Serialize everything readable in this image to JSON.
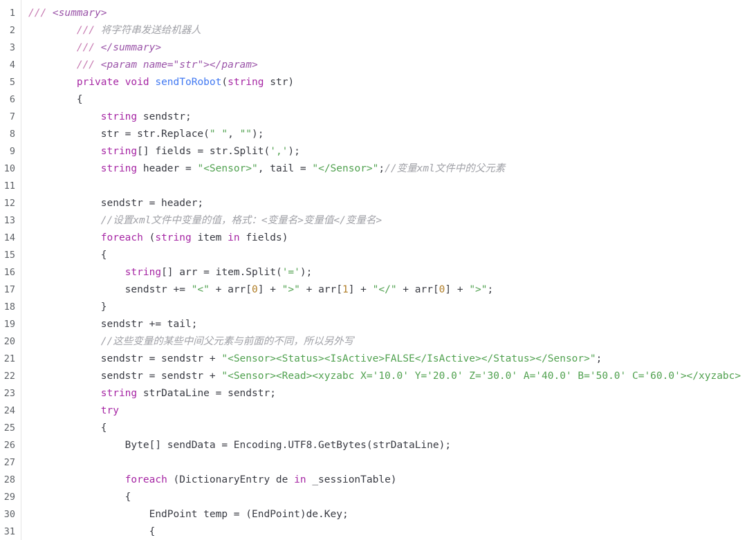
{
  "editor": {
    "language": "csharp",
    "background_color": "#ffffff",
    "gutter_divider_color": "#e4e4e4",
    "first_visible_line": 1,
    "last_visible_line": 31,
    "horizontal_overflow": true
  },
  "theme": {
    "plain": "#383a42",
    "keyword": "#a626a4",
    "type": "#a626a4",
    "function": "#4078f2",
    "string": "#50a14f",
    "number": "#b07d26",
    "comment": "#a0a1a7",
    "doc_slash": "#c678b0",
    "doc_tag": "#9a53a8",
    "line_number": "#5d6166"
  },
  "line_numbers": [
    "1",
    "2",
    "3",
    "4",
    "5",
    "6",
    "7",
    "8",
    "9",
    "10",
    "11",
    "12",
    "13",
    "14",
    "15",
    "16",
    "17",
    "18",
    "19",
    "20",
    "21",
    "22",
    "23",
    "24",
    "25",
    "26",
    "27",
    "28",
    "29",
    "30",
    "31"
  ],
  "code_lines": [
    {
      "number": "1",
      "text": "/// <summary>",
      "tokens": [
        {
          "t": "/// ",
          "c": "doc-slash"
        },
        {
          "t": "<summary>",
          "c": "doc-tag"
        }
      ]
    },
    {
      "number": "2",
      "text": "        /// 将字符串发送给机器人",
      "tokens": [
        {
          "t": "        ",
          "c": "plain"
        },
        {
          "t": "/// ",
          "c": "doc-slash"
        },
        {
          "t": "将字符串发送给机器人",
          "c": "comment"
        }
      ]
    },
    {
      "number": "3",
      "text": "        /// </summary>",
      "tokens": [
        {
          "t": "        ",
          "c": "plain"
        },
        {
          "t": "/// ",
          "c": "doc-slash"
        },
        {
          "t": "</summary>",
          "c": "doc-tag"
        }
      ]
    },
    {
      "number": "4",
      "text": "        /// <param name=\"str\"></param>",
      "tokens": [
        {
          "t": "        ",
          "c": "plain"
        },
        {
          "t": "/// ",
          "c": "doc-slash"
        },
        {
          "t": "<param name=\"str\"></param>",
          "c": "doc-tag"
        }
      ]
    },
    {
      "number": "5",
      "text": "        private void sendToRobot(string str)",
      "tokens": [
        {
          "t": "        ",
          "c": "plain"
        },
        {
          "t": "private",
          "c": "keyword"
        },
        {
          "t": " ",
          "c": "plain"
        },
        {
          "t": "void",
          "c": "keyword"
        },
        {
          "t": " ",
          "c": "plain"
        },
        {
          "t": "sendToRobot",
          "c": "function"
        },
        {
          "t": "(",
          "c": "punct"
        },
        {
          "t": "string",
          "c": "type"
        },
        {
          "t": " str)",
          "c": "plain"
        }
      ]
    },
    {
      "number": "6",
      "text": "        {",
      "tokens": [
        {
          "t": "        {",
          "c": "plain"
        }
      ]
    },
    {
      "number": "7",
      "text": "            string sendstr;",
      "tokens": [
        {
          "t": "            ",
          "c": "plain"
        },
        {
          "t": "string",
          "c": "type"
        },
        {
          "t": " sendstr;",
          "c": "plain"
        }
      ]
    },
    {
      "number": "8",
      "text": "            str = str.Replace(\" \", \"\");",
      "tokens": [
        {
          "t": "            str = str.Replace(",
          "c": "plain"
        },
        {
          "t": "\" \"",
          "c": "string"
        },
        {
          "t": ", ",
          "c": "plain"
        },
        {
          "t": "\"\"",
          "c": "string"
        },
        {
          "t": ");",
          "c": "plain"
        }
      ]
    },
    {
      "number": "9",
      "text": "            string[] fields = str.Split(',');",
      "tokens": [
        {
          "t": "            ",
          "c": "plain"
        },
        {
          "t": "string",
          "c": "type"
        },
        {
          "t": "[] fields = str.Split(",
          "c": "plain"
        },
        {
          "t": "','",
          "c": "string"
        },
        {
          "t": ");",
          "c": "plain"
        }
      ]
    },
    {
      "number": "10",
      "text": "            string header = \"<Sensor>\", tail = \"</Sensor>\";//变量xml文件中的父元素",
      "tokens": [
        {
          "t": "            ",
          "c": "plain"
        },
        {
          "t": "string",
          "c": "type"
        },
        {
          "t": " header = ",
          "c": "plain"
        },
        {
          "t": "\"<Sensor>\"",
          "c": "string"
        },
        {
          "t": ", tail = ",
          "c": "plain"
        },
        {
          "t": "\"</Sensor>\"",
          "c": "string"
        },
        {
          "t": ";",
          "c": "plain"
        },
        {
          "t": "//变量xml文件中的父元素",
          "c": "comment"
        }
      ]
    },
    {
      "number": "11",
      "text": "",
      "tokens": []
    },
    {
      "number": "12",
      "text": "            sendstr = header;",
      "tokens": [
        {
          "t": "            sendstr = header;",
          "c": "plain"
        }
      ]
    },
    {
      "number": "13",
      "text": "            //设置xml文件中变量的值，格式：<变量名>变量值</变量名>",
      "tokens": [
        {
          "t": "            ",
          "c": "plain"
        },
        {
          "t": "//设置xml文件中变量的值，格式：<变量名>变量值</变量名>",
          "c": "comment"
        }
      ]
    },
    {
      "number": "14",
      "text": "            foreach (string item in fields)",
      "tokens": [
        {
          "t": "            ",
          "c": "plain"
        },
        {
          "t": "foreach",
          "c": "keyword"
        },
        {
          "t": " (",
          "c": "plain"
        },
        {
          "t": "string",
          "c": "type"
        },
        {
          "t": " item ",
          "c": "plain"
        },
        {
          "t": "in",
          "c": "keyword"
        },
        {
          "t": " fields)",
          "c": "plain"
        }
      ]
    },
    {
      "number": "15",
      "text": "            {",
      "tokens": [
        {
          "t": "            {",
          "c": "plain"
        }
      ]
    },
    {
      "number": "16",
      "text": "                string[] arr = item.Split('=');",
      "tokens": [
        {
          "t": "                ",
          "c": "plain"
        },
        {
          "t": "string",
          "c": "type"
        },
        {
          "t": "[] arr = item.Split(",
          "c": "plain"
        },
        {
          "t": "'='",
          "c": "string"
        },
        {
          "t": ");",
          "c": "plain"
        }
      ]
    },
    {
      "number": "17",
      "text": "                sendstr += \"<\" + arr[0] + \">\" + arr[1] + \"</\" + arr[0] + \">\";",
      "tokens": [
        {
          "t": "                sendstr += ",
          "c": "plain"
        },
        {
          "t": "\"<\"",
          "c": "string"
        },
        {
          "t": " + arr[",
          "c": "plain"
        },
        {
          "t": "0",
          "c": "number"
        },
        {
          "t": "] + ",
          "c": "plain"
        },
        {
          "t": "\">\"",
          "c": "string"
        },
        {
          "t": " + arr[",
          "c": "plain"
        },
        {
          "t": "1",
          "c": "number"
        },
        {
          "t": "] + ",
          "c": "plain"
        },
        {
          "t": "\"</\"",
          "c": "string"
        },
        {
          "t": " + arr[",
          "c": "plain"
        },
        {
          "t": "0",
          "c": "number"
        },
        {
          "t": "] + ",
          "c": "plain"
        },
        {
          "t": "\">\"",
          "c": "string"
        },
        {
          "t": ";",
          "c": "plain"
        }
      ]
    },
    {
      "number": "18",
      "text": "            }",
      "tokens": [
        {
          "t": "            }",
          "c": "plain"
        }
      ]
    },
    {
      "number": "19",
      "text": "            sendstr += tail;",
      "tokens": [
        {
          "t": "            sendstr += tail;",
          "c": "plain"
        }
      ]
    },
    {
      "number": "20",
      "text": "            //这些变量的某些中间父元素与前面的不同，所以另外写",
      "tokens": [
        {
          "t": "            ",
          "c": "plain"
        },
        {
          "t": "//这些变量的某些中间父元素与前面的不同，所以另外写",
          "c": "comment"
        }
      ]
    },
    {
      "number": "21",
      "text": "            sendstr = sendstr + \"<Sensor><Status><IsActive>FALSE</IsActive></Status></Sensor>\";",
      "tokens": [
        {
          "t": "            sendstr = sendstr + ",
          "c": "plain"
        },
        {
          "t": "\"<Sensor><Status><IsActive>FALSE</IsActive></Status></Sensor>\"",
          "c": "string"
        },
        {
          "t": ";",
          "c": "plain"
        }
      ]
    },
    {
      "number": "22",
      "text": "            sendstr = sendstr + \"<Sensor><Read><xyzabc X='10.0' Y='20.0' Z='30.0' A='40.0' B='50.0' C='60.0'></xyzabc>",
      "tokens": [
        {
          "t": "            sendstr = sendstr + ",
          "c": "plain"
        },
        {
          "t": "\"<Sensor><Read><xyzabc X='10.0' Y='20.0' Z='30.0' A='40.0' B='50.0' C='60.0'></xyzabc>",
          "c": "string"
        }
      ]
    },
    {
      "number": "23",
      "text": "            string strDataLine = sendstr;",
      "tokens": [
        {
          "t": "            ",
          "c": "plain"
        },
        {
          "t": "string",
          "c": "type"
        },
        {
          "t": " strDataLine = sendstr;",
          "c": "plain"
        }
      ]
    },
    {
      "number": "24",
      "text": "            try",
      "tokens": [
        {
          "t": "            ",
          "c": "plain"
        },
        {
          "t": "try",
          "c": "keyword"
        }
      ]
    },
    {
      "number": "25",
      "text": "            {",
      "tokens": [
        {
          "t": "            {",
          "c": "plain"
        }
      ]
    },
    {
      "number": "26",
      "text": "                Byte[] sendData = Encoding.UTF8.GetBytes(strDataLine);",
      "tokens": [
        {
          "t": "                Byte[] sendData = Encoding.UTF8.GetBytes(strDataLine);",
          "c": "plain"
        }
      ]
    },
    {
      "number": "27",
      "text": "",
      "tokens": []
    },
    {
      "number": "28",
      "text": "                foreach (DictionaryEntry de in _sessionTable)",
      "tokens": [
        {
          "t": "                ",
          "c": "plain"
        },
        {
          "t": "foreach",
          "c": "keyword"
        },
        {
          "t": " (DictionaryEntry de ",
          "c": "plain"
        },
        {
          "t": "in",
          "c": "keyword"
        },
        {
          "t": " _sessionTable)",
          "c": "plain"
        }
      ]
    },
    {
      "number": "29",
      "text": "                {",
      "tokens": [
        {
          "t": "                {",
          "c": "plain"
        }
      ]
    },
    {
      "number": "30",
      "text": "                    EndPoint temp = (EndPoint)de.Key;",
      "tokens": [
        {
          "t": "                    EndPoint temp = (EndPoint)de.Key;",
          "c": "plain"
        }
      ]
    },
    {
      "number": "31",
      "text": "                    {",
      "tokens": [
        {
          "t": "                    {",
          "c": "plain"
        }
      ]
    }
  ]
}
